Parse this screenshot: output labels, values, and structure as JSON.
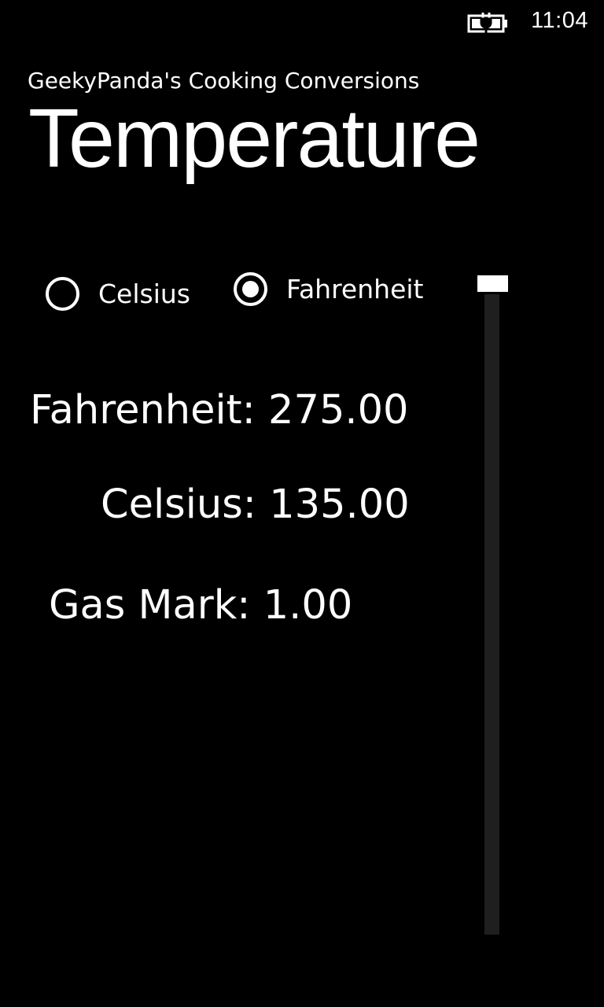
{
  "status_bar": {
    "battery_icon": "battery-charging-icon",
    "time": "11:04"
  },
  "app": {
    "title": "GeekyPanda's Cooking Conversions",
    "page_title": "Temperature"
  },
  "unit_selector": {
    "options": [
      {
        "label": "Celsius",
        "checked": false
      },
      {
        "label": "Fahrenheit",
        "checked": true
      }
    ]
  },
  "slider": {
    "orientation": "vertical",
    "value_fraction": 0.0
  },
  "results": {
    "fahrenheit": {
      "label": "Fahrenheit:",
      "value": "275.00"
    },
    "celsius": {
      "label": "Celsius:",
      "value": "135.00"
    },
    "gas_mark": {
      "label": "Gas Mark:",
      "value": "1.00"
    }
  },
  "colors": {
    "background": "#000000",
    "foreground": "#ffffff",
    "slider_track": "#1f1f1f"
  }
}
